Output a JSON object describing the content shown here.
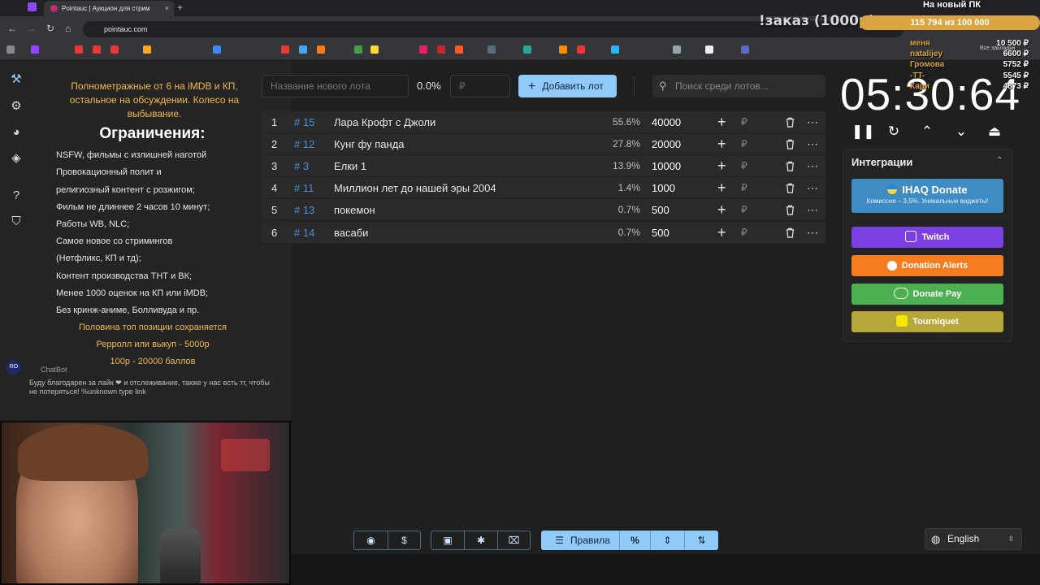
{
  "browser": {
    "tab_title": "Pointauc | Аукцион для стрим",
    "tab_close": "×",
    "new_tab": "+",
    "url": "pointauc.com",
    "all_bookmarks": "Все закладки"
  },
  "overlay": {
    "order": "!заказ (1000р)",
    "new_pc": "На новый ПК",
    "progress": "115 794  из 100 000",
    "donors": [
      {
        "name": "меня",
        "amount": "10 500 ₽"
      },
      {
        "name": "natalijey",
        "amount": "6600 ₽"
      },
      {
        "name": "Громова",
        "amount": "5752 ₽"
      },
      {
        "name": "-TT-",
        "amount": "5545 ₽"
      },
      {
        "name": "Кари",
        "amount": "4873 ₽"
      }
    ]
  },
  "rules": {
    "top_text": "Полнометражные от 6 на iMDB и КП, остальное на обсуждении. Колесо на выбывание.",
    "title": "Ограничения:",
    "lines": [
      "NSFW, фильмы с излишней наготой",
      "Провокационный полит и",
      "религиозный контент с розжигом;",
      "Фильм не длиннее 2 часов 10 минут;",
      "Работы WB, NLC;",
      "Самое новое со стримингов",
      "(Нетфликс, КП и тд);",
      "Контент производства ТНТ и ВК;",
      "Менее 1000 оценок на КП или iMDB;",
      "Без кринж-аниме, Болливуда и пр."
    ],
    "gold_lines": [
      "Половина топ позиции сохраняется",
      "Рерролл или выкуп - 5000р",
      "100р - 20000 баллов"
    ]
  },
  "chat": {
    "avatar": "RO",
    "name": "ChatBot",
    "message": "Буду благодарен за лайк ❤ и отслеживание, также у нас есть тг, чтобы не потеряться! %unknown type link"
  },
  "auction": {
    "name_placeholder": "Название нового лота",
    "total_percent": "0.0%",
    "amount_placeholder": "₽",
    "add_button": "Добавить лот",
    "search_placeholder": "Поиск среди лотов...",
    "lots": [
      {
        "n": "1",
        "id": "# 15",
        "name": "Лара Крофт с Джоли",
        "percent": "55.6%",
        "amount": "40000"
      },
      {
        "n": "2",
        "id": "# 12",
        "name": "Кунг фу панда",
        "percent": "27.8%",
        "amount": "20000"
      },
      {
        "n": "3",
        "id": "# 3",
        "name": "Елки 1",
        "percent": "13.9%",
        "amount": "10000"
      },
      {
        "n": "4",
        "id": "# 11",
        "name": "Миллион лет до нашей эры 2004",
        "percent": "1.4%",
        "amount": "1000"
      },
      {
        "n": "5",
        "id": "# 13",
        "name": "покемон",
        "percent": "0.7%",
        "amount": "500"
      },
      {
        "n": "6",
        "id": "# 14",
        "name": "васаби",
        "percent": "0.7%",
        "amount": "500"
      }
    ]
  },
  "toolbar": {
    "rules_label": "Правила",
    "percent_label": "%"
  },
  "timer": {
    "value": "05:30:64"
  },
  "integrations": {
    "title": "Интеграции",
    "ihaq_title": "IHAQ Donate",
    "ihaq_subtitle": "Комиссия – 3,5%. Уникальные виджеты!",
    "buttons": [
      {
        "label": "Twitch",
        "color": "#7b3fe4"
      },
      {
        "label": "Donation Alerts",
        "color": "#f57c1f"
      },
      {
        "label": "Donate Pay",
        "color": "#4caf50"
      },
      {
        "label": "Tourniquet",
        "color": "#b5a73a"
      }
    ]
  },
  "language": {
    "selected": "English"
  }
}
